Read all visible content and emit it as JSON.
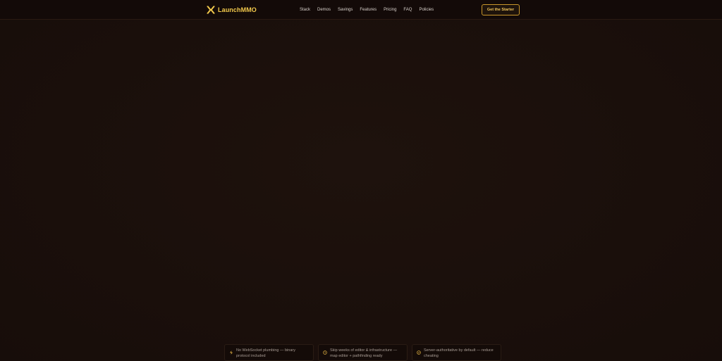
{
  "brand": {
    "name": "LaunchMMO",
    "accent_color": "#f2c94c",
    "icon": "x-logo-icon"
  },
  "nav": {
    "links": [
      "Stack",
      "Demos",
      "Savings",
      "Features",
      "Pricing",
      "FAQ",
      "Policies"
    ],
    "cta_label": "Get the Starter"
  },
  "features": [
    {
      "icon": "zap-icon",
      "text_line1": "No WebSocket plumbing — binary",
      "text_line2": "protocol included"
    },
    {
      "icon": "clock-icon",
      "text_line1": "Skip weeks of editor & infrastructure —",
      "text_line2": "map editor + pathfinding ready"
    },
    {
      "icon": "shield-icon",
      "text_line1": "Server-authoritative by default — reduce",
      "text_line2": "cheating"
    }
  ],
  "colors": {
    "background": "#1b0f0b",
    "navbar": "#130a08",
    "cta_border": "#c9962b",
    "cta_text": "#f0c45a"
  }
}
